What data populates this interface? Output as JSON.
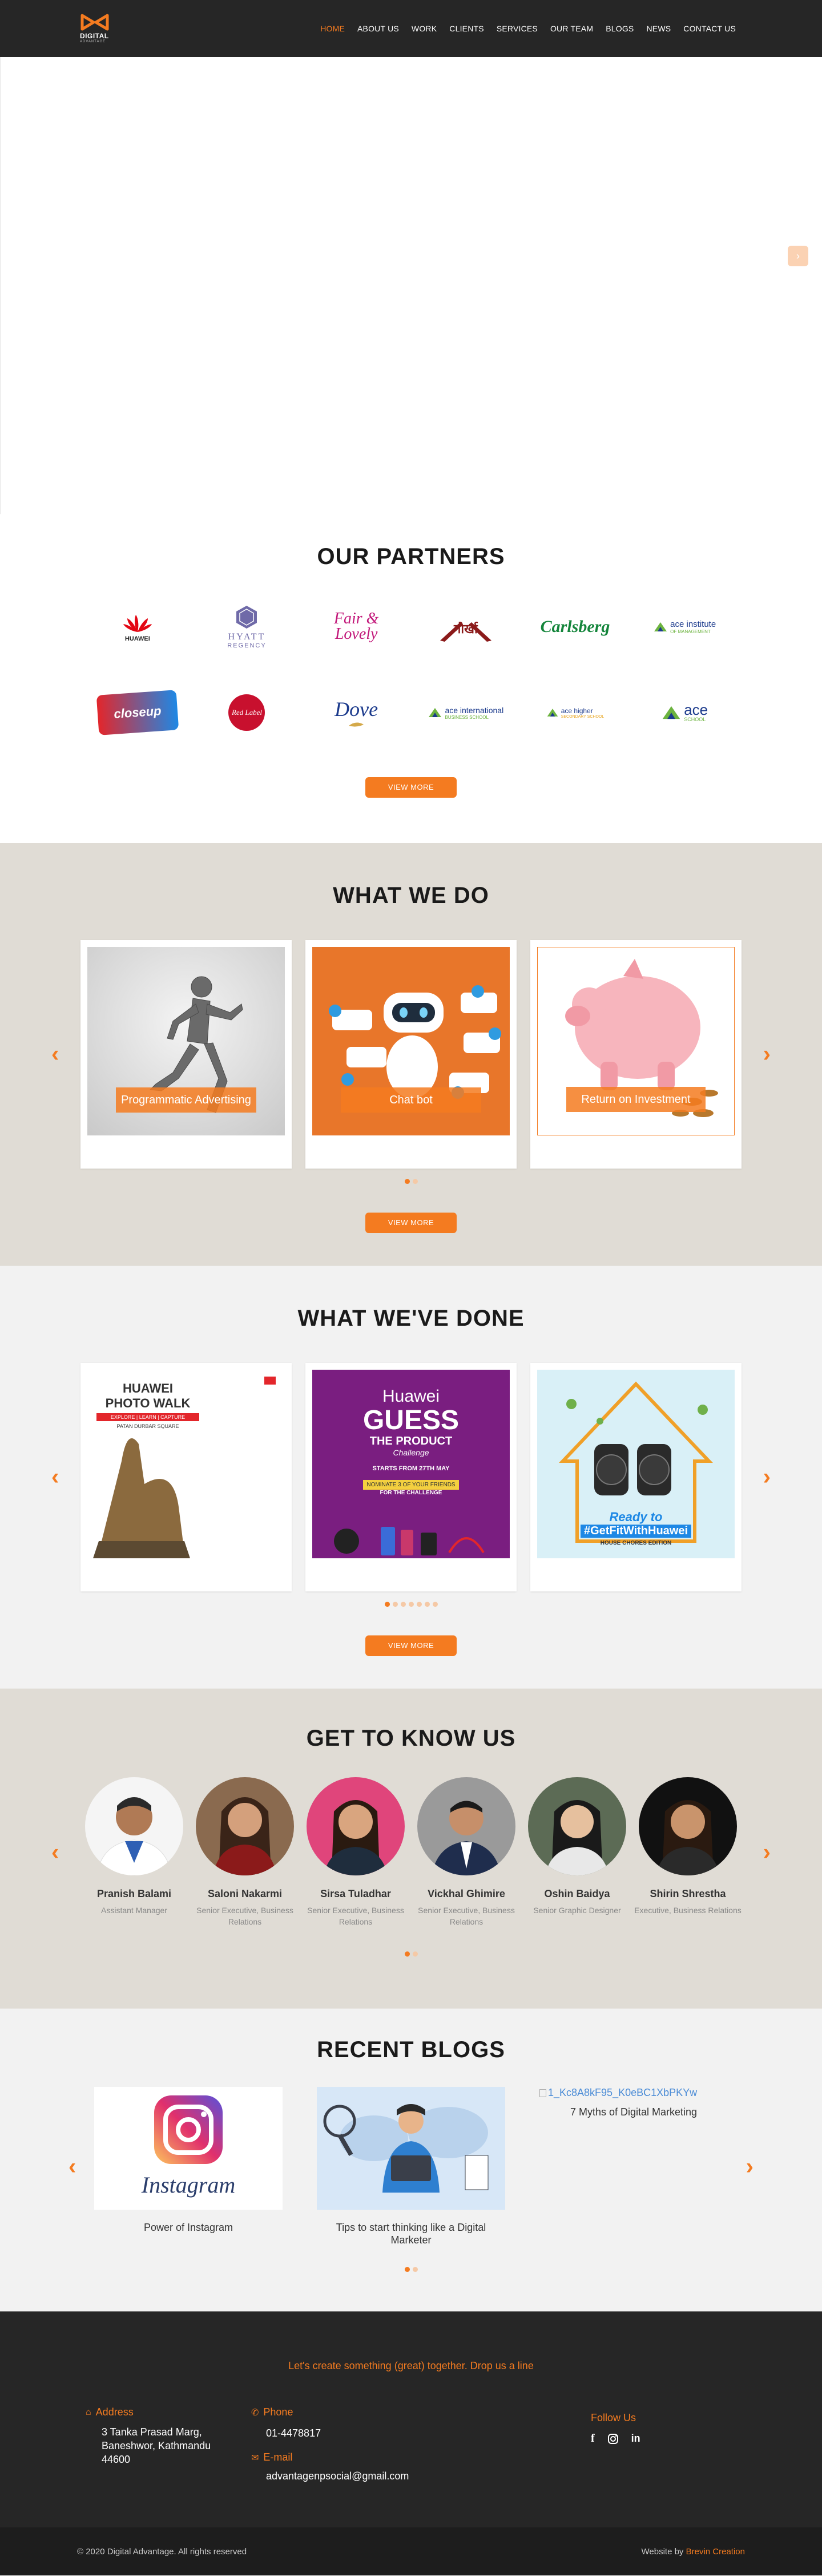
{
  "colors": {
    "accent": "#f47b20",
    "header_bg": "#262626",
    "beige": "#e0dcd5",
    "light": "#f2f2f2"
  },
  "header": {
    "logo_text": "DIGITAL",
    "logo_sub": "ADVANTAGE",
    "nav": [
      "HOME",
      "ABOUT US",
      "WORK",
      "CLIENTS",
      "SERVICES",
      "OUR TEAM",
      "BLOGS",
      "NEWS",
      "CONTACT US"
    ],
    "active": "HOME"
  },
  "hero": {
    "next_icon": "chevron-right-icon"
  },
  "partners": {
    "title": "OUR PARTNERS",
    "logos": [
      "HUAWEI",
      "HYATT",
      "REGENCY",
      "Fair &",
      "Lovely",
      "गोर्खा",
      "Carlsberg",
      "ace institute",
      "OF MANAGEMENT",
      "closeup",
      "Red Label",
      "Dove",
      "ace international",
      "BUSINESS SCHOOL",
      "ace higher",
      "SECONDARY SCHOOL",
      "ace",
      "SCHOOL"
    ],
    "button": "VIEW MORE"
  },
  "whatwedo": {
    "title": "WHAT WE DO",
    "cards": [
      "Programmatic Advertising",
      "Chat bot",
      "Return on Investment"
    ],
    "button": "VIEW MORE"
  },
  "done": {
    "title": "WHAT WE'VE DONE",
    "card1": {
      "brand": "HUAWEI",
      "line1": "PHOTO WALK",
      "line2": "EXPLORE | LEARN | CAPTURE",
      "line3": "PATAN DURBAR SQUARE"
    },
    "card2": {
      "line1": "Huawei",
      "line2": "GUESS",
      "line3": "THE PRODUCT",
      "line4": "Challenge",
      "line5": "STARTS FROM 27TH MAY",
      "line6": "NOMINATE 3 OF YOUR FRIENDS",
      "line7": "FOR THE CHALLENGE"
    },
    "card3": {
      "line1": "Ready to",
      "line2": "#GetFitWithHuawei",
      "line3": "HOUSE CHORES EDITION"
    },
    "button": "VIEW MORE"
  },
  "team": {
    "title": "GET TO KNOW US",
    "members": [
      {
        "name": "Pranish Balami",
        "role": "Assistant Manager"
      },
      {
        "name": "Saloni Nakarmi",
        "role": "Senior Executive, Business Relations"
      },
      {
        "name": "Sirsa Tuladhar",
        "role": "Senior Executive, Business Relations"
      },
      {
        "name": "Vickhal Ghimire",
        "role": "Senior Executive, Business Relations"
      },
      {
        "name": "Oshin Baidya",
        "role": "Senior Graphic Designer"
      },
      {
        "name": "Shirin Shrestha",
        "role": "Executive, Business Relations"
      }
    ]
  },
  "blogs": {
    "title": "RECENT BLOGS",
    "items": [
      {
        "title": "Power of Instagram",
        "img_text": "Instagram"
      },
      {
        "title": "Tips to start thinking like a Digital Marketer",
        "img_text": ""
      },
      {
        "title": "7 Myths of Digital Marketing",
        "img_text": "1_Kc8A8kF95_K0eBC1XbPKYw"
      }
    ]
  },
  "footer": {
    "tagline": "Let's create something (great) together. Drop us a line",
    "address_label": "Address",
    "address": "3 Tanka Prasad Marg, Baneshwor, Kathmandu 44600",
    "phone_label": "Phone",
    "phone": "01-4478817",
    "email_label": "E-mail",
    "email": "advantagenpsocial@gmail.com",
    "follow": "Follow Us",
    "copyright": "© 2020 Digital Advantage. All rights reserved",
    "website_by": "Website by",
    "creator": "Brevin Creation"
  }
}
